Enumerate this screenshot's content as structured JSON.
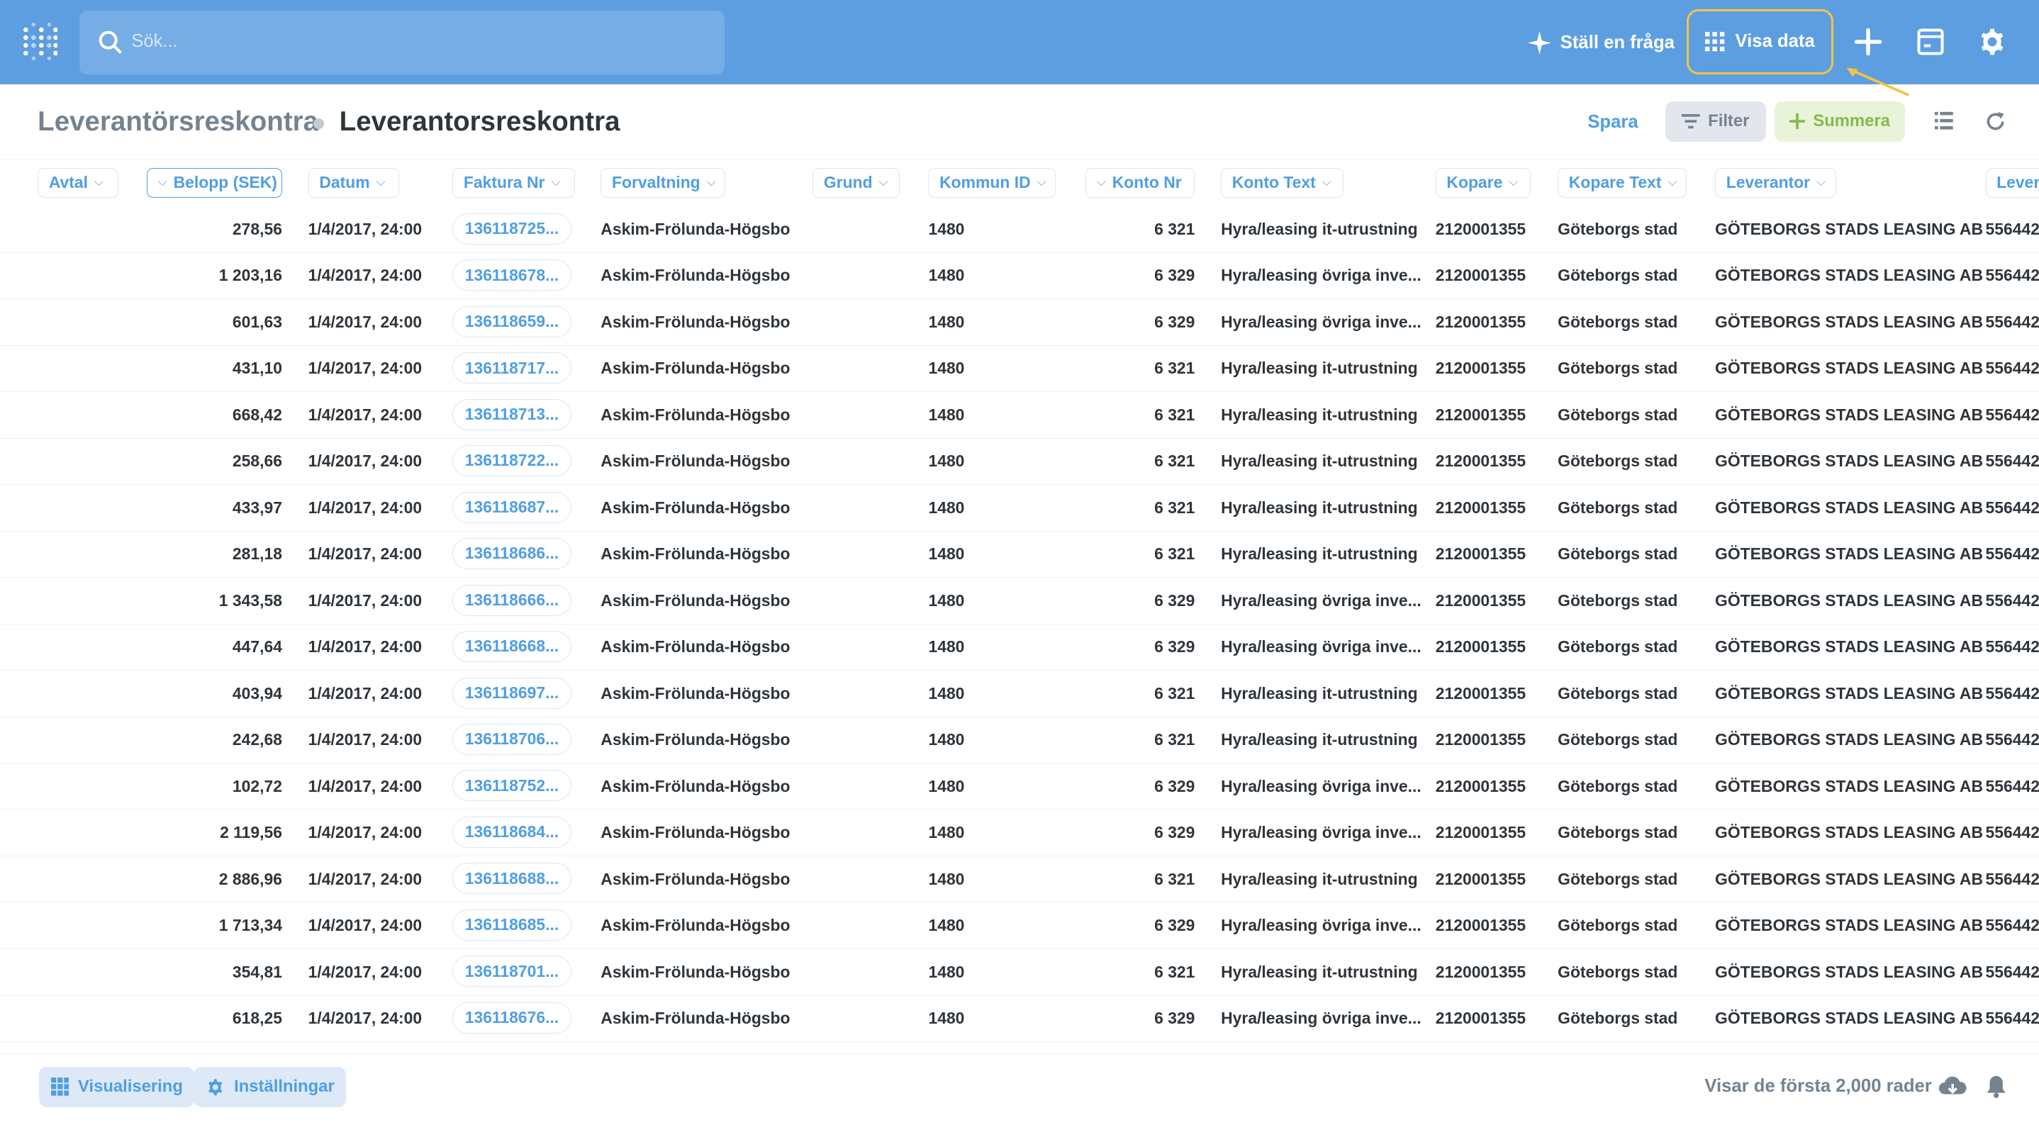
{
  "topbar": {
    "search_placeholder": "Sök...",
    "ask_label": "Ställ en fråga",
    "visa_label": "Visa data",
    "bg_color": "#5d9ee0",
    "highlight_color": "#f5c342"
  },
  "header": {
    "breadcrumb_parent": "Leverantörsreskontra",
    "title": "Leverantorsreskontra",
    "save_label": "Spara",
    "filter_label": "Filter",
    "summarize_label": "Summera"
  },
  "table": {
    "columns": [
      "Avtal",
      "Belopp (SEK)",
      "Datum",
      "Faktura Nr",
      "Forvaltning",
      "Grund",
      "Kommun ID",
      "Konto Nr",
      "Konto Text",
      "Kopare",
      "Kopare Text",
      "Leverantor",
      "Lever"
    ],
    "rows": [
      [
        "",
        "278,56",
        "1/4/2017, 24:00",
        "136118725...",
        "Askim-Frölunda-Högsbo",
        "",
        "1480",
        "6 321",
        "Hyra/leasing it-utrustning",
        "2120001355",
        "Göteborgs stad",
        "GÖTEBORGS STADS LEASING AB",
        "556442"
      ],
      [
        "",
        "1 203,16",
        "1/4/2017, 24:00",
        "136118678...",
        "Askim-Frölunda-Högsbo",
        "",
        "1480",
        "6 329",
        "Hyra/leasing övriga inve...",
        "2120001355",
        "Göteborgs stad",
        "GÖTEBORGS STADS LEASING AB",
        "556442"
      ],
      [
        "",
        "601,63",
        "1/4/2017, 24:00",
        "136118659...",
        "Askim-Frölunda-Högsbo",
        "",
        "1480",
        "6 329",
        "Hyra/leasing övriga inve...",
        "2120001355",
        "Göteborgs stad",
        "GÖTEBORGS STADS LEASING AB",
        "556442"
      ],
      [
        "",
        "431,10",
        "1/4/2017, 24:00",
        "136118717...",
        "Askim-Frölunda-Högsbo",
        "",
        "1480",
        "6 321",
        "Hyra/leasing it-utrustning",
        "2120001355",
        "Göteborgs stad",
        "GÖTEBORGS STADS LEASING AB",
        "556442"
      ],
      [
        "",
        "668,42",
        "1/4/2017, 24:00",
        "136118713...",
        "Askim-Frölunda-Högsbo",
        "",
        "1480",
        "6 321",
        "Hyra/leasing it-utrustning",
        "2120001355",
        "Göteborgs stad",
        "GÖTEBORGS STADS LEASING AB",
        "556442"
      ],
      [
        "",
        "258,66",
        "1/4/2017, 24:00",
        "136118722...",
        "Askim-Frölunda-Högsbo",
        "",
        "1480",
        "6 321",
        "Hyra/leasing it-utrustning",
        "2120001355",
        "Göteborgs stad",
        "GÖTEBORGS STADS LEASING AB",
        "556442"
      ],
      [
        "",
        "433,97",
        "1/4/2017, 24:00",
        "136118687...",
        "Askim-Frölunda-Högsbo",
        "",
        "1480",
        "6 321",
        "Hyra/leasing it-utrustning",
        "2120001355",
        "Göteborgs stad",
        "GÖTEBORGS STADS LEASING AB",
        "556442"
      ],
      [
        "",
        "281,18",
        "1/4/2017, 24:00",
        "136118686...",
        "Askim-Frölunda-Högsbo",
        "",
        "1480",
        "6 321",
        "Hyra/leasing it-utrustning",
        "2120001355",
        "Göteborgs stad",
        "GÖTEBORGS STADS LEASING AB",
        "556442"
      ],
      [
        "",
        "1 343,58",
        "1/4/2017, 24:00",
        "136118666...",
        "Askim-Frölunda-Högsbo",
        "",
        "1480",
        "6 329",
        "Hyra/leasing övriga inve...",
        "2120001355",
        "Göteborgs stad",
        "GÖTEBORGS STADS LEASING AB",
        "556442"
      ],
      [
        "",
        "447,64",
        "1/4/2017, 24:00",
        "136118668...",
        "Askim-Frölunda-Högsbo",
        "",
        "1480",
        "6 329",
        "Hyra/leasing övriga inve...",
        "2120001355",
        "Göteborgs stad",
        "GÖTEBORGS STADS LEASING AB",
        "556442"
      ],
      [
        "",
        "403,94",
        "1/4/2017, 24:00",
        "136118697...",
        "Askim-Frölunda-Högsbo",
        "",
        "1480",
        "6 321",
        "Hyra/leasing it-utrustning",
        "2120001355",
        "Göteborgs stad",
        "GÖTEBORGS STADS LEASING AB",
        "556442"
      ],
      [
        "",
        "242,68",
        "1/4/2017, 24:00",
        "136118706...",
        "Askim-Frölunda-Högsbo",
        "",
        "1480",
        "6 321",
        "Hyra/leasing it-utrustning",
        "2120001355",
        "Göteborgs stad",
        "GÖTEBORGS STADS LEASING AB",
        "556442"
      ],
      [
        "",
        "102,72",
        "1/4/2017, 24:00",
        "136118752...",
        "Askim-Frölunda-Högsbo",
        "",
        "1480",
        "6 329",
        "Hyra/leasing övriga inve...",
        "2120001355",
        "Göteborgs stad",
        "GÖTEBORGS STADS LEASING AB",
        "556442"
      ],
      [
        "",
        "2 119,56",
        "1/4/2017, 24:00",
        "136118684...",
        "Askim-Frölunda-Högsbo",
        "",
        "1480",
        "6 329",
        "Hyra/leasing övriga inve...",
        "2120001355",
        "Göteborgs stad",
        "GÖTEBORGS STADS LEASING AB",
        "556442"
      ],
      [
        "",
        "2 886,96",
        "1/4/2017, 24:00",
        "136118688...",
        "Askim-Frölunda-Högsbo",
        "",
        "1480",
        "6 321",
        "Hyra/leasing it-utrustning",
        "2120001355",
        "Göteborgs stad",
        "GÖTEBORGS STADS LEASING AB",
        "556442"
      ],
      [
        "",
        "1 713,34",
        "1/4/2017, 24:00",
        "136118685...",
        "Askim-Frölunda-Högsbo",
        "",
        "1480",
        "6 329",
        "Hyra/leasing övriga inve...",
        "2120001355",
        "Göteborgs stad",
        "GÖTEBORGS STADS LEASING AB",
        "556442"
      ],
      [
        "",
        "354,81",
        "1/4/2017, 24:00",
        "136118701...",
        "Askim-Frölunda-Högsbo",
        "",
        "1480",
        "6 321",
        "Hyra/leasing it-utrustning",
        "2120001355",
        "Göteborgs stad",
        "GÖTEBORGS STADS LEASING AB",
        "556442"
      ],
      [
        "",
        "618,25",
        "1/4/2017, 24:00",
        "136118676...",
        "Askim-Frölunda-Högsbo",
        "",
        "1480",
        "6 329",
        "Hyra/leasing övriga inve...",
        "2120001355",
        "Göteborgs stad",
        "GÖTEBORGS STADS LEASING AB",
        "556442"
      ]
    ]
  },
  "footer": {
    "visualize_label": "Visualisering",
    "settings_label": "Inställningar",
    "row_count": "Visar de första 2,000 rader"
  }
}
